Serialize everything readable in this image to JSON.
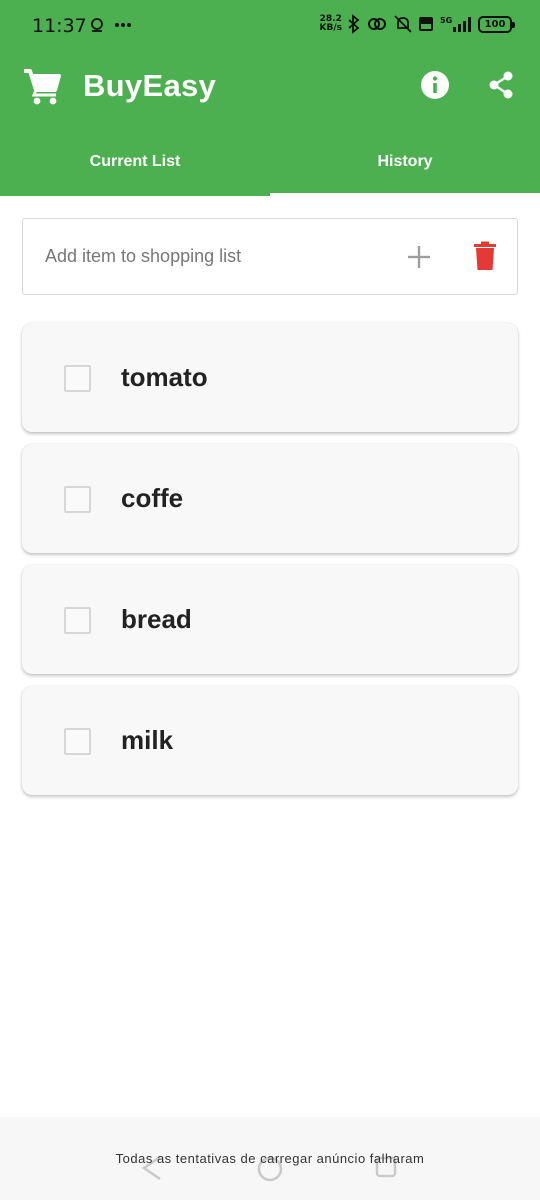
{
  "status_bar": {
    "time": "11:37",
    "net_speed_value": "28.2",
    "net_speed_unit": "KB/s",
    "battery": "100"
  },
  "app": {
    "title": "BuyEasy",
    "brand_color": "#4caf50"
  },
  "tabs": [
    {
      "label": "Current List",
      "active": true
    },
    {
      "label": "History",
      "active": false
    }
  ],
  "add_item": {
    "placeholder": "Add item to shopping list",
    "value": ""
  },
  "items": [
    {
      "label": "tomato",
      "checked": false
    },
    {
      "label": "coffe",
      "checked": false
    },
    {
      "label": "bread",
      "checked": false
    },
    {
      "label": "milk",
      "checked": false
    }
  ],
  "ad": {
    "text": "Todas as tentativas de carregar anúncio falharam"
  },
  "icons": {
    "toolbar_left": "cart-icon",
    "toolbar_info": "info-icon",
    "toolbar_share": "share-icon",
    "add": "plus-icon",
    "clear": "trash-icon"
  },
  "colors": {
    "trash": "#e53935",
    "plus": "#9e9e9e"
  }
}
